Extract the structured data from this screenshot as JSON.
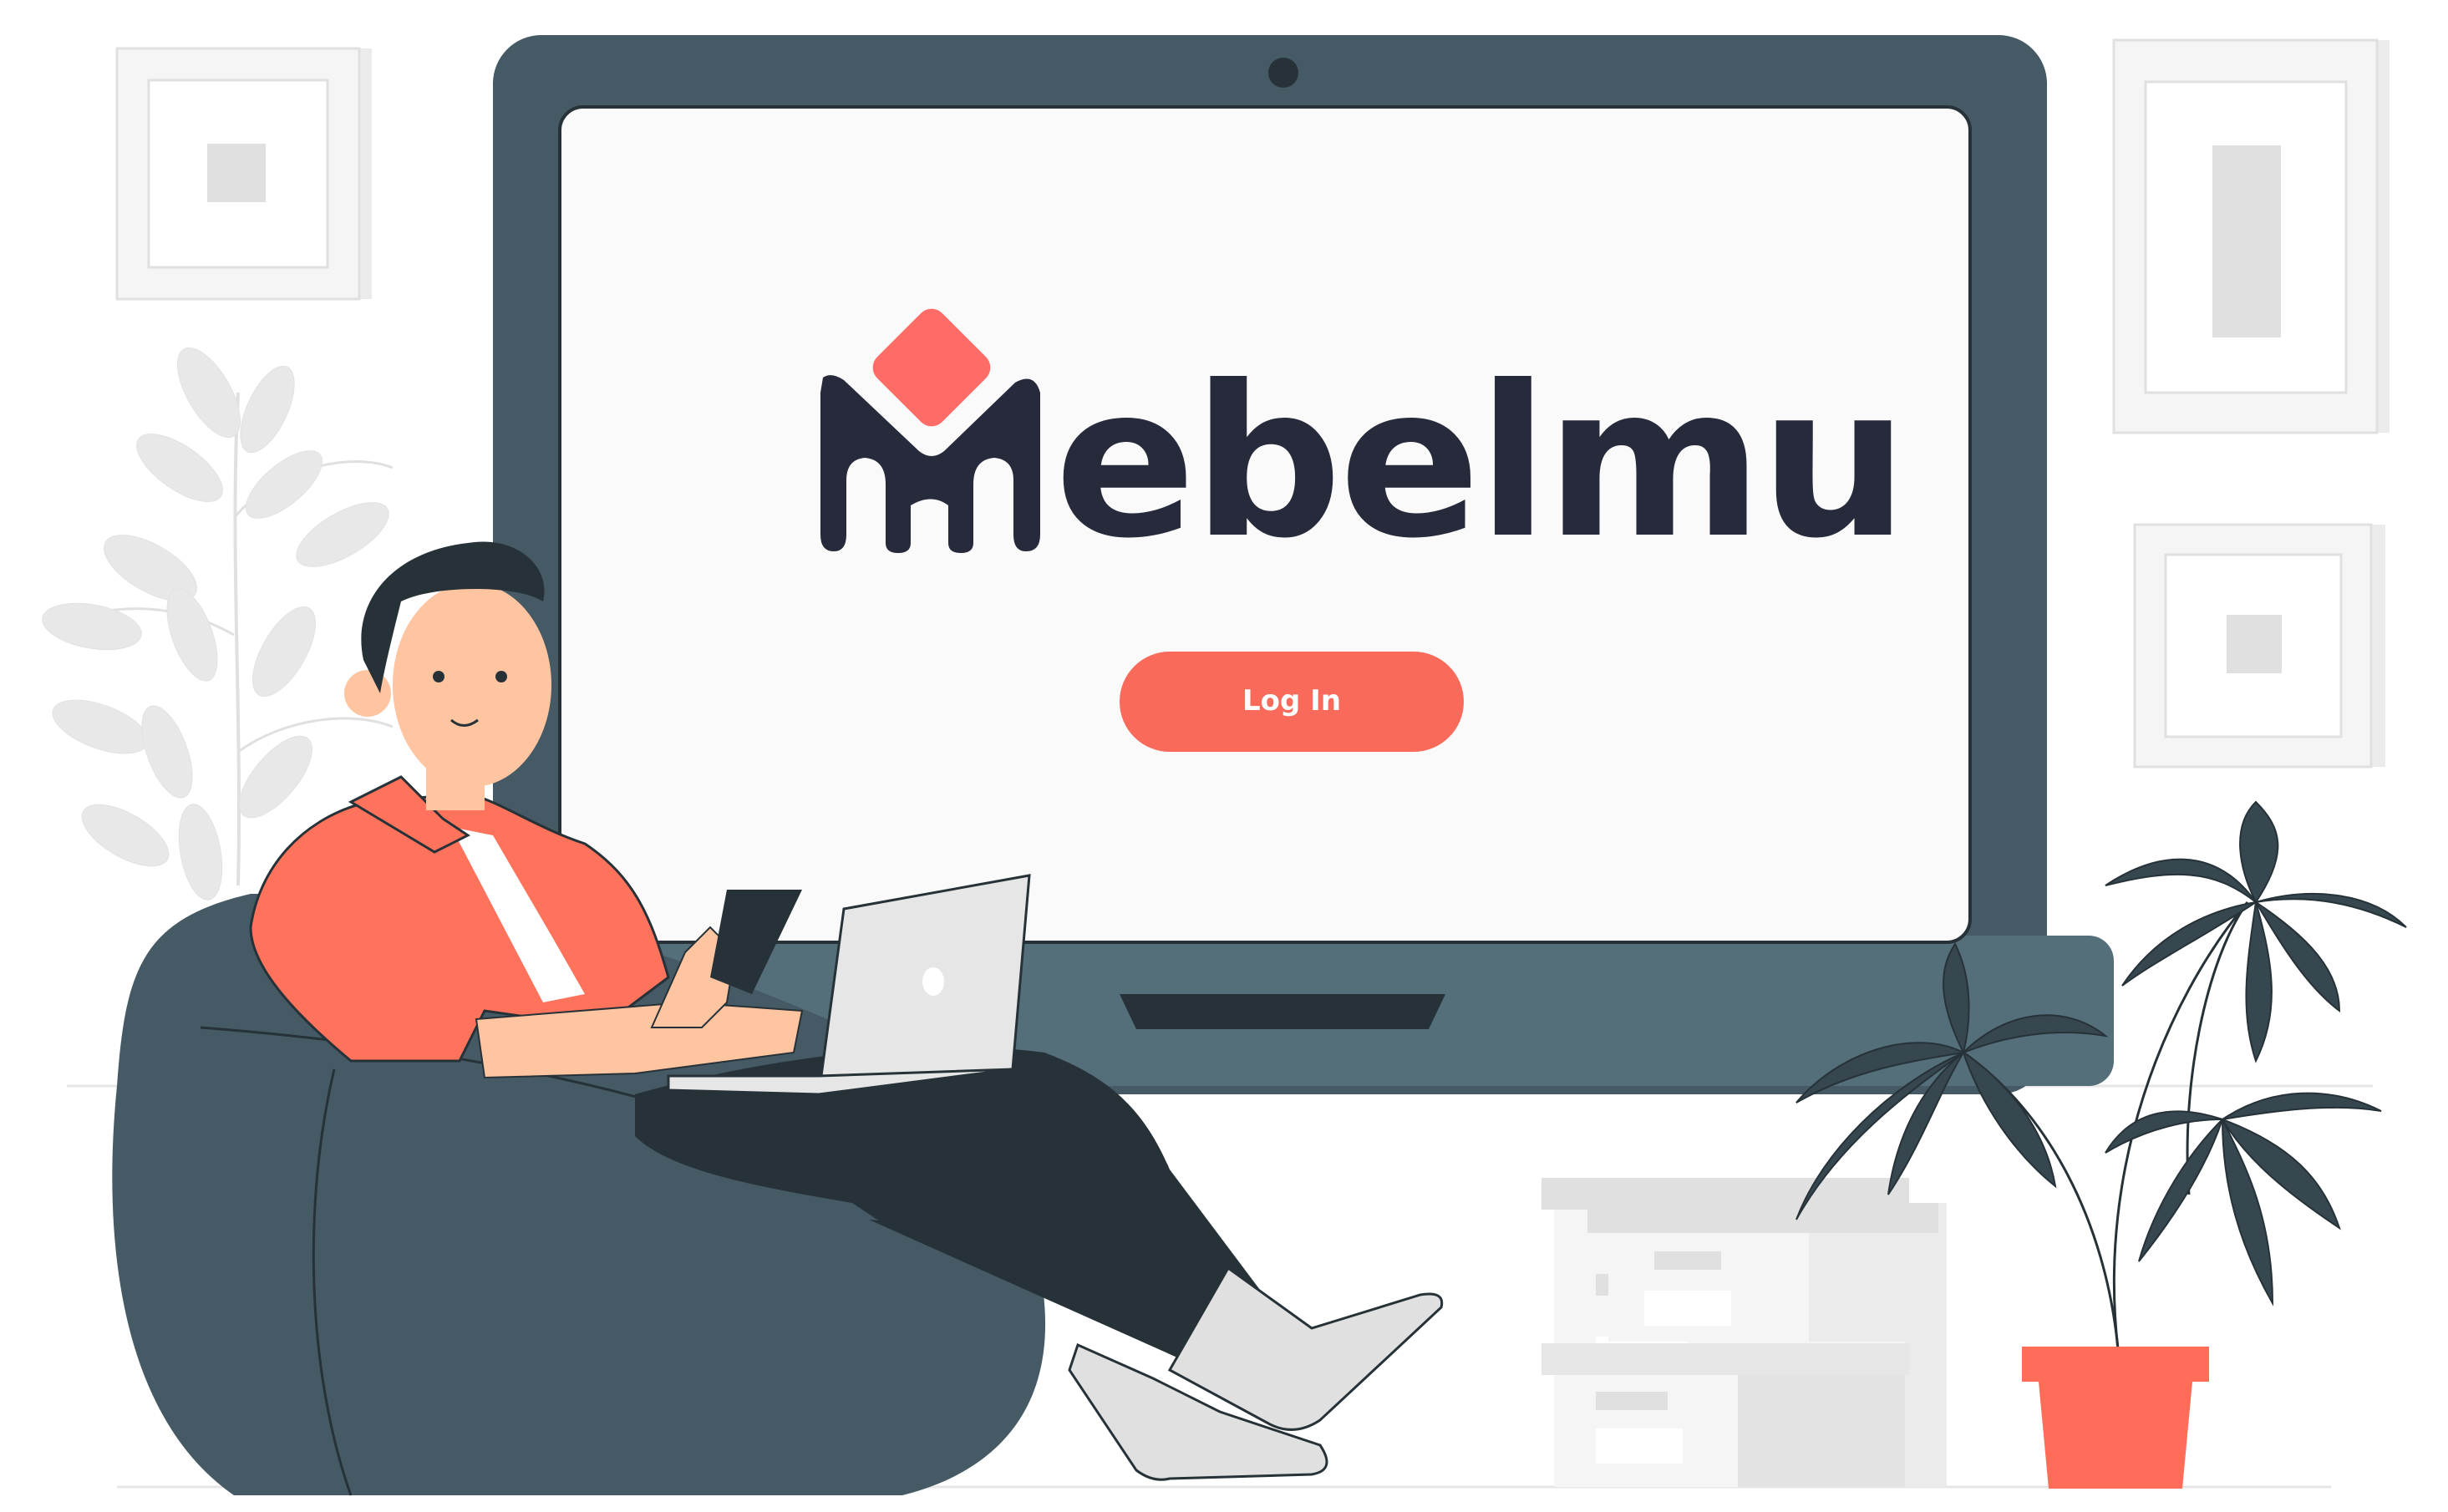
{
  "brand": {
    "name_rest": "ebelmu",
    "logo_letter": "M",
    "logo_color": "#262a3b",
    "accent_color": "#ff6b66"
  },
  "login": {
    "label": "Log In",
    "color": "#f96a5a"
  },
  "colors": {
    "monitor": "#455a64",
    "screen": "#fafafa",
    "shirt": "#ff735c",
    "skin": "#ffc4a0",
    "pants": "#263238",
    "beanbag": "#455a64",
    "plant": "#263238",
    "pot": "#ff6c58"
  },
  "icons": [
    "webcam-icon",
    "apple-logo-icon",
    "house-logo-icon"
  ]
}
